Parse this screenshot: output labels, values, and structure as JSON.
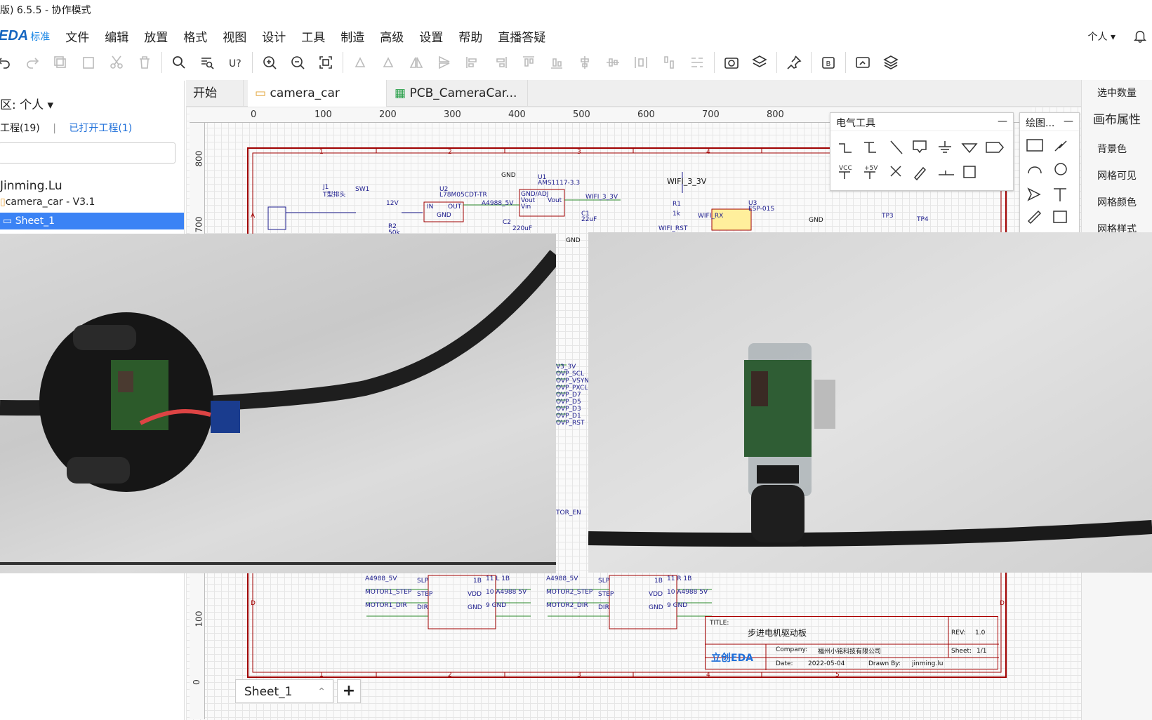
{
  "window": {
    "title": "版) 6.5.5 - 协作模式"
  },
  "menubar": {
    "logo": "EDA",
    "logo_sub": "标准",
    "items": [
      "文件",
      "编辑",
      "放置",
      "格式",
      "视图",
      "设计",
      "工具",
      "制造",
      "高级",
      "设置",
      "帮助",
      "直播答疑"
    ],
    "user_label": "个人"
  },
  "left_panel": {
    "zone_label": "区: 个人",
    "projects_link": "工程(19)",
    "opened_link": "已打开工程(1)",
    "user_name": "Jinming.Lu",
    "project_name": "camera_car - V3.1",
    "sheet_name": "Sheet_1"
  },
  "tabs": [
    {
      "label": "开始"
    },
    {
      "label": "camera_car"
    },
    {
      "label": "PCB_CameraCar..."
    }
  ],
  "right_panel": {
    "header": "选中数量",
    "section": "画布属性",
    "items": [
      "背景色",
      "网格可见",
      "网格颜色",
      "网格样式"
    ]
  },
  "electrical_tools": {
    "title": "电气工具",
    "icons": [
      "wire-icon",
      "bus-icon",
      "line-icon",
      "net-label-icon",
      "ground-icon",
      "gnd-symbol-icon",
      "net-port-icon",
      "vcc-icon",
      "5v-icon",
      "no-connect-icon",
      "pen-icon",
      "probe-icon",
      "select-icon"
    ],
    "vcc_label": "VCC",
    "p5v_label": "+5V"
  },
  "drawing_tools": {
    "title": "绘图..."
  },
  "ruler": {
    "marks": [
      "0",
      "100",
      "200",
      "300",
      "400",
      "500",
      "600",
      "700",
      "800"
    ],
    "side_marks": [
      "800",
      "700",
      "100",
      "0"
    ]
  },
  "schematic": {
    "labels": {
      "j1": "J1",
      "j1_desc": "T型排头",
      "sw1": "SW1",
      "u2": "U2",
      "u2_part": "L78M05CDT-TR",
      "u1": "U1",
      "u1_part": "AMS1117-3.3",
      "gnd": "GND",
      "wifi": "WIFI_3_3V",
      "r1": "R1",
      "r1_val": "1k",
      "u3": "U3",
      "u3_part": "ESP-01S",
      "tp3": "TP3",
      "tp4": "TP4",
      "wifi_rx": "WIFI_RX",
      "wifi_rst": "WIFI_RST",
      "c1": "C1",
      "c1_val": "22uF",
      "c2": "C2",
      "c2_val": "220uF",
      "r2": "R2",
      "r2_val": "50k",
      "v12": "12V",
      "a4988": "A4988_5V",
      "pin_in": "IN",
      "pin_out": "OUT",
      "pin_gnd": "GND",
      "pin_gnd_adj": "GND/ADJ",
      "pin_vout": "Vout",
      "pin_vin": "Vin"
    },
    "left_nets": [
      "A4988_5V",
      "MOTOR1_STEP",
      "MOTOR1_DIR"
    ],
    "right_nets": [
      "A4988_5V",
      "MOTOR2_STEP",
      "MOTOR2_DIR"
    ],
    "pins_left": [
      "SLP",
      "STEP",
      "DIR"
    ],
    "pins_right": [
      "1B",
      "VDD",
      "GND"
    ],
    "net_out1": [
      "11 L 1B",
      "10 A4988 5V",
      "9 GND"
    ],
    "net_out2": [
      "11 R 1B",
      "10 A4988 5V",
      "9 GND"
    ],
    "cam_nets": [
      "V3_3V",
      "OVP_SCL",
      "OVP_VSYN",
      "OVP_PXCLK",
      "OVP_D7",
      "OVP_D5",
      "OVP_D3",
      "OVP_D1",
      "OVP_RST"
    ],
    "motor_en": "TOR_EN",
    "title_block": {
      "title_label": "TITLE:",
      "title": "步进电机驱动板",
      "rev_label": "REV:",
      "rev": "1.0",
      "company_label": "Company:",
      "company": "福州小铭科技有限公司",
      "sheet_label": "Sheet:",
      "sheet": "1/1",
      "date_label": "Date:",
      "date": "2022-05-04",
      "drawn_label": "Drawn By:",
      "drawn": "jinming.lu",
      "logo": "立创EDA"
    },
    "col_numbers": [
      "1",
      "2",
      "3",
      "4",
      "5"
    ],
    "row_letters": [
      "A",
      "D"
    ]
  },
  "bottom": {
    "sheet_tab": "Sheet_1",
    "add": "+"
  },
  "colors": {
    "accent": "#3b83f5",
    "schematic_border": "#a00000",
    "link": "#1e6fd9"
  }
}
